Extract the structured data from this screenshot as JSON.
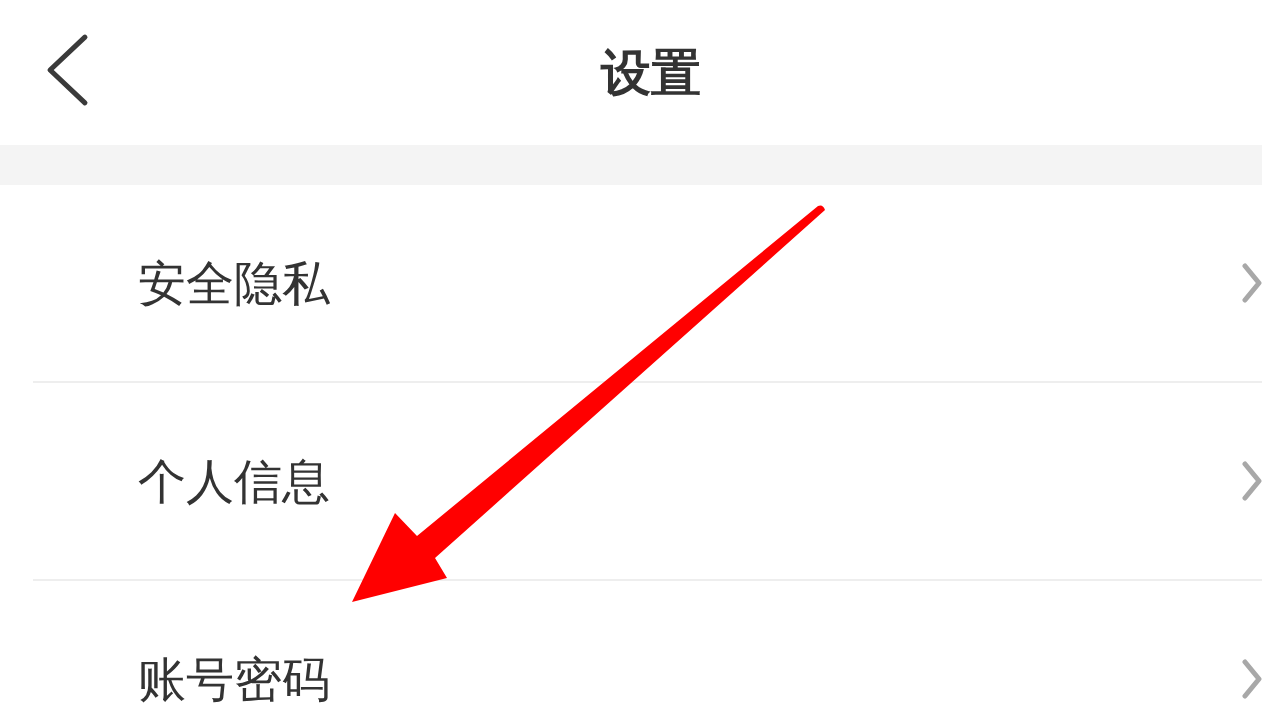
{
  "header": {
    "title": "设置"
  },
  "settings_items": [
    {
      "label": "安全隐私"
    },
    {
      "label": "个人信息"
    },
    {
      "label": "账号密码"
    }
  ]
}
